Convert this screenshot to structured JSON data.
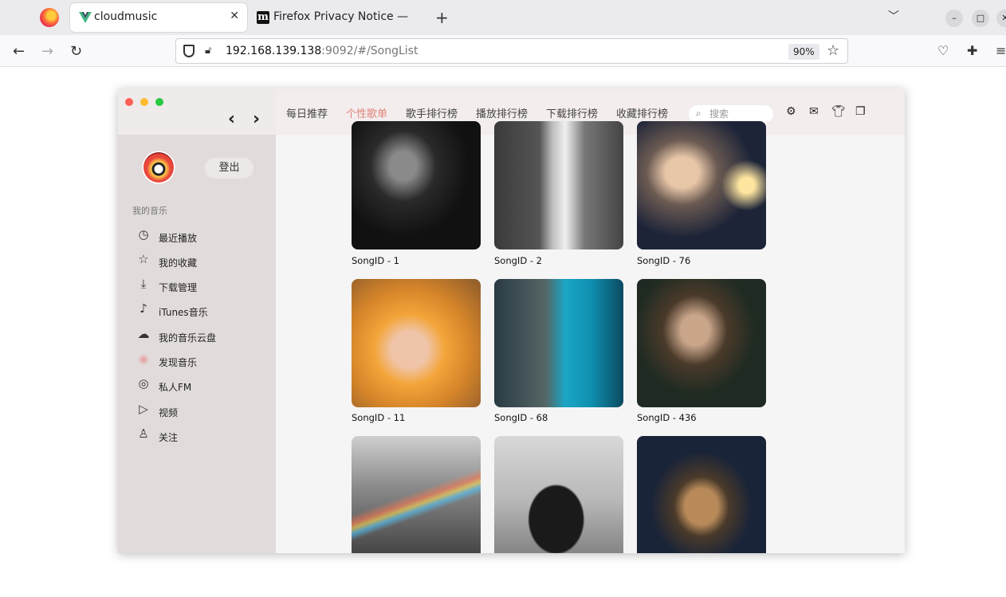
{
  "browser": {
    "tabs": [
      {
        "title": "cloudmusic"
      },
      {
        "title": "Firefox Privacy Notice —"
      }
    ],
    "url_host": "192.168.139.138",
    "url_rest": ":9092/#/SongList",
    "zoom": "90%"
  },
  "header": {
    "nav": [
      "每日推荐",
      "个性歌单",
      "歌手排行榜",
      "播放排行榜",
      "下载排行榜",
      "收藏排行榜"
    ],
    "active_nav": "个性歌单",
    "search_placeholder": "搜索"
  },
  "sidebar": {
    "logout_label": "登出",
    "section_title": "我的音乐",
    "items": [
      {
        "label": "最近播放",
        "icon": "history-icon"
      },
      {
        "label": "我的收藏",
        "icon": "star-icon"
      },
      {
        "label": "下载管理",
        "icon": "download-icon"
      },
      {
        "label": "iTunes音乐",
        "icon": "music-note-icon"
      },
      {
        "label": "我的音乐云盘",
        "icon": "cloud-icon"
      },
      {
        "label": "发现音乐",
        "icon": "discover-music-icon"
      },
      {
        "label": "私人FM",
        "icon": "radio-icon"
      },
      {
        "label": "视频",
        "icon": "video-icon"
      },
      {
        "label": "关注",
        "icon": "user-follow-icon"
      }
    ]
  },
  "songs": [
    {
      "caption": "SongID - 1"
    },
    {
      "caption": "SongID - 2"
    },
    {
      "caption": "SongID - 76"
    },
    {
      "caption": "SongID - 11"
    },
    {
      "caption": "SongID - 68"
    },
    {
      "caption": "SongID - 436"
    },
    {
      "caption": ""
    },
    {
      "caption": ""
    },
    {
      "caption": ""
    }
  ],
  "colors": {
    "accent": "#e0827a",
    "sidebar_bg": "#e1dcdb",
    "topnav_bg": "#f3eded"
  }
}
